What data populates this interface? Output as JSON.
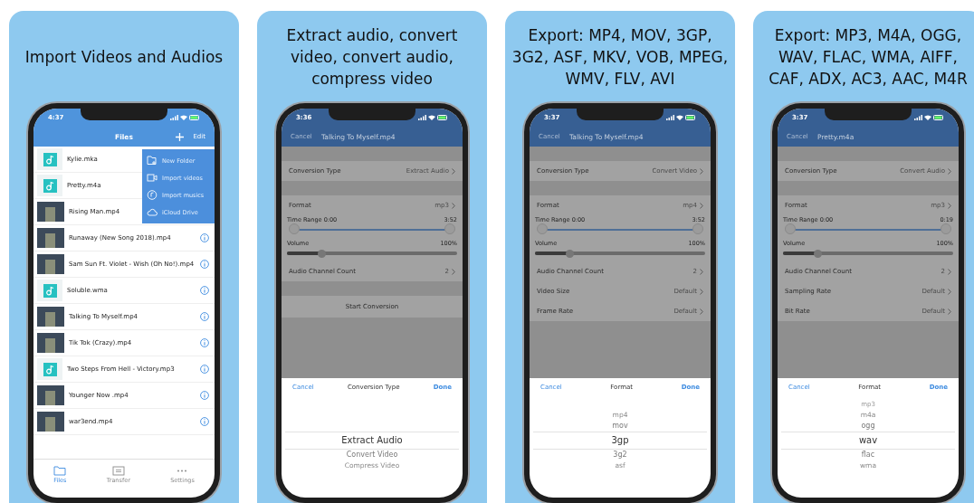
{
  "panels": [
    {
      "kind": "files",
      "caption": "Import Videos and Audios",
      "time": "4:37",
      "title": "Files",
      "edit": "Edit",
      "menu": [
        {
          "label": "New Folder",
          "kind": "folder"
        },
        {
          "label": "Import videos",
          "kind": "video"
        },
        {
          "label": "Import musics",
          "kind": "music"
        },
        {
          "label": "iCloud Drive",
          "kind": "cloud"
        }
      ],
      "files": [
        {
          "name": "Kylie.mka",
          "kind": "audio",
          "info": false
        },
        {
          "name": "Pretty.m4a",
          "kind": "audio",
          "info": false
        },
        {
          "name": "Rising Man.mp4",
          "kind": "video",
          "info": false
        },
        {
          "name": "Runaway (New Song 2018).mp4",
          "kind": "video",
          "info": true
        },
        {
          "name": "Sam Sun Ft. Violet - Wish (Oh No!).mp4",
          "kind": "video",
          "info": true
        },
        {
          "name": "Soluble.wma",
          "kind": "audio",
          "info": true
        },
        {
          "name": "Talking To Myself.mp4",
          "kind": "video",
          "info": true
        },
        {
          "name": "Tik Tok (Crazy).mp4",
          "kind": "video",
          "info": true
        },
        {
          "name": "Two Steps From Hell - Victory.mp3",
          "kind": "audio",
          "info": true
        },
        {
          "name": "Younger Now .mp4",
          "kind": "video",
          "info": true
        },
        {
          "name": "war3end.mp4",
          "kind": "video",
          "info": true
        }
      ],
      "tabs": [
        {
          "label": "Files",
          "kind": "folder",
          "selected": true
        },
        {
          "label": "Transfer",
          "kind": "transfer",
          "selected": false
        },
        {
          "label": "Settings",
          "kind": "dots",
          "selected": false
        }
      ]
    },
    {
      "kind": "converter",
      "caption": "Extract audio, convert video, convert audio, compress video",
      "time": "3:36",
      "cancel": "Cancel",
      "title": "Talking To Myself.mp4",
      "items": [
        {
          "kind": "spacer"
        },
        {
          "kind": "row",
          "label": "Conversion Type",
          "value": "Extract Audio"
        },
        {
          "kind": "spacer"
        },
        {
          "kind": "row",
          "label": "Format",
          "value": "mp3"
        },
        {
          "kind": "range",
          "label": "Time Range",
          "start": "0:00",
          "end": "3:52",
          "level": 1
        },
        {
          "kind": "volume",
          "label": "Volume",
          "reading": "100%",
          "level": 0.2
        },
        {
          "kind": "row",
          "label": "Audio Channel Count",
          "value": "2"
        },
        {
          "kind": "spacer"
        },
        {
          "kind": "button",
          "label": "Start Conversion"
        }
      ],
      "picker": {
        "cancel": "Cancel",
        "title": "Conversion Type",
        "done": "Done",
        "options": [
          {
            "label": "Extract Audio",
            "selected": true
          },
          {
            "label": "Convert Video",
            "selected": false
          },
          {
            "label": "Compress Video",
            "selected": false
          }
        ]
      }
    },
    {
      "kind": "converter",
      "caption": "Export: MP4, MOV, 3GP, 3G2, ASF, MKV, VOB, MPEG, WMV, FLV, AVI",
      "time": "3:37",
      "cancel": "Cancel",
      "title": "Talking To Myself.mp4",
      "items": [
        {
          "kind": "spacer"
        },
        {
          "kind": "row",
          "label": "Conversion Type",
          "value": "Convert Video"
        },
        {
          "kind": "spacer"
        },
        {
          "kind": "row",
          "label": "Format",
          "value": "mp4"
        },
        {
          "kind": "range",
          "label": "Time Range",
          "start": "0:00",
          "end": "3:52",
          "level": 1
        },
        {
          "kind": "volume",
          "label": "Volume",
          "reading": "100%",
          "level": 0.2
        },
        {
          "kind": "row",
          "label": "Audio Channel Count",
          "value": "2"
        },
        {
          "kind": "row",
          "label": "Video Size",
          "value": "Default"
        },
        {
          "kind": "row",
          "label": "Frame Rate",
          "value": "Default"
        }
      ],
      "picker": {
        "cancel": "Cancel",
        "title": "Format",
        "done": "Done",
        "options": [
          {
            "label": "mp4",
            "selected": false
          },
          {
            "label": "mov",
            "selected": false
          },
          {
            "label": "3gp",
            "selected": true
          },
          {
            "label": "3g2",
            "selected": false
          },
          {
            "label": "asf",
            "selected": false
          }
        ]
      }
    },
    {
      "kind": "converter",
      "caption": "Export: MP3, M4A, OGG, WAV, FLAC, WMA, AIFF, CAF, ADX, AC3, AAC, M4R",
      "time": "3:37",
      "cancel": "Cancel",
      "title": "Pretty.m4a",
      "items": [
        {
          "kind": "spacer"
        },
        {
          "kind": "row",
          "label": "Conversion Type",
          "value": "Convert Audio"
        },
        {
          "kind": "spacer"
        },
        {
          "kind": "row",
          "label": "Format",
          "value": "mp3"
        },
        {
          "kind": "range",
          "label": "Time Range",
          "start": "0:00",
          "end": "0:19",
          "level": 1
        },
        {
          "kind": "volume",
          "label": "Volume",
          "reading": "100%",
          "level": 0.2
        },
        {
          "kind": "row",
          "label": "Audio Channel Count",
          "value": "2"
        },
        {
          "kind": "row",
          "label": "Sampling Rate",
          "value": "Default"
        },
        {
          "kind": "row",
          "label": "Bit Rate",
          "value": "Default"
        }
      ],
      "picker": {
        "cancel": "Cancel",
        "title": "Format",
        "done": "Done",
        "options": [
          {
            "label": "mp3",
            "selected": false
          },
          {
            "label": "m4a",
            "selected": false
          },
          {
            "label": "ogg",
            "selected": false
          },
          {
            "label": "wav",
            "selected": true
          },
          {
            "label": "flac",
            "selected": false
          },
          {
            "label": "wma",
            "selected": false
          }
        ]
      }
    }
  ]
}
